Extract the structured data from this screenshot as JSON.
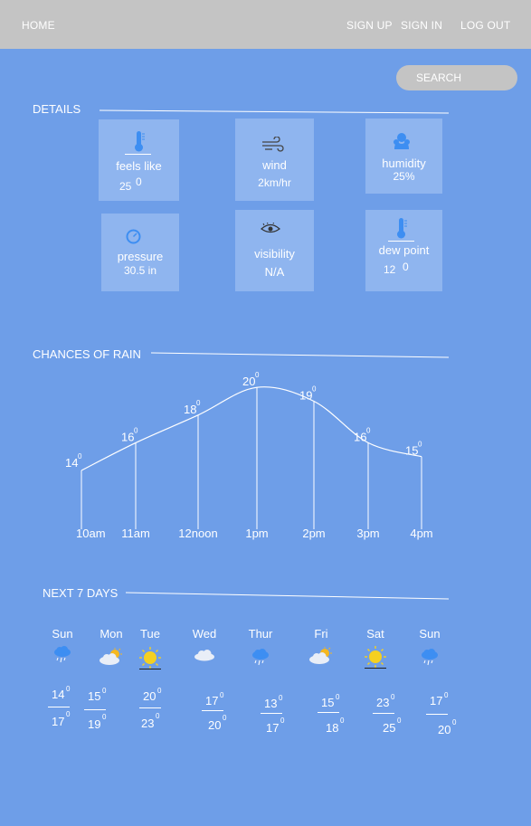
{
  "nav": {
    "home": "HOME",
    "signup": "SIGN UP",
    "signin": "SIGN IN",
    "logout": "LOG OUT"
  },
  "search": {
    "placeholder": "SEARCH"
  },
  "details": {
    "title": "DETAILS",
    "feels_like": {
      "label": "feels like",
      "value": "25",
      "unit": "0",
      "icon": "thermometer-icon"
    },
    "wind": {
      "label": "wind",
      "value": "2km/hr",
      "icon": "wind-icon"
    },
    "humidity": {
      "label": "humidity",
      "value": "25%",
      "icon": "humidity-icon"
    },
    "pressure": {
      "label": "pressure",
      "value": "30.5 in",
      "icon": "pressure-gauge-icon"
    },
    "visibility": {
      "label": "visibility",
      "value": "N/A",
      "icon": "eye-icon"
    },
    "dew_point": {
      "label": "dew point",
      "value": "12",
      "unit": "0",
      "icon": "thermometer-icon"
    }
  },
  "rain": {
    "title": "CHANCES OF RAIN"
  },
  "chart_data": {
    "type": "line",
    "x": [
      "10am",
      "11am",
      "12noon",
      "1pm",
      "2pm",
      "3pm",
      "4pm"
    ],
    "values": [
      14,
      16,
      18,
      20,
      19,
      16,
      15
    ],
    "value_labels": [
      "14",
      "16",
      "18",
      "20",
      "19",
      "16",
      "15"
    ],
    "unit_sup": "0",
    "grid": false
  },
  "week": {
    "title": "NEXT 7 DAYS",
    "days": [
      {
        "name": "Sun",
        "icon": "rain-cloud-icon",
        "top": "14",
        "bottom": "17"
      },
      {
        "name": "Mon",
        "icon": "partly-cloudy-icon",
        "top": "15",
        "bottom": "19"
      },
      {
        "name": "Tue",
        "icon": "sun-icon",
        "top": "20",
        "bottom": "23"
      },
      {
        "name": "Wed",
        "icon": "cloud-icon",
        "top": "17",
        "bottom": "20"
      },
      {
        "name": "Thur",
        "icon": "rain-cloud-icon",
        "top": "13",
        "bottom": "17"
      },
      {
        "name": "Fri",
        "icon": "partly-cloudy-icon",
        "top": "15",
        "bottom": "18"
      },
      {
        "name": "Sat",
        "icon": "sun-icon",
        "top": "23",
        "bottom": "25"
      },
      {
        "name": "Sun",
        "icon": "rain-cloud-icon",
        "top": "17",
        "bottom": "20"
      }
    ],
    "sup": "0"
  },
  "colors": {
    "background": "#6e9ee8",
    "card": "#8fb5ef",
    "topbar": "#c4c4c4",
    "icon_blue": "#3d8ef2"
  }
}
